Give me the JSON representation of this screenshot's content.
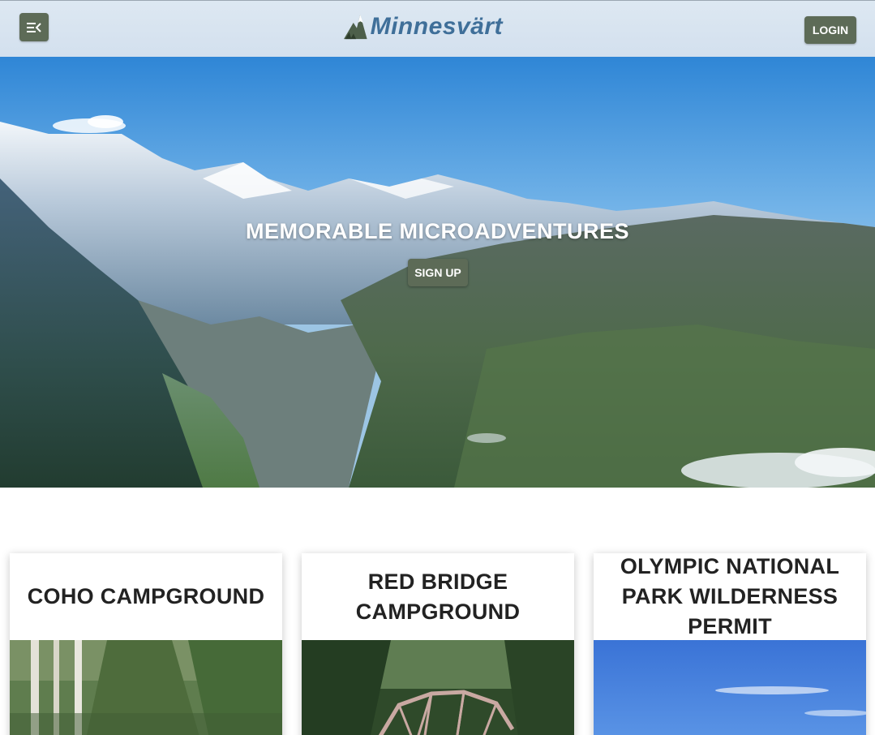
{
  "header": {
    "menu_icon": "menu-collapse-icon",
    "logo_text": "Minnesvärt",
    "login_label": "LOGIN"
  },
  "hero": {
    "title": "MEMORABLE MICROADVENTURES",
    "signup_label": "SIGN UP",
    "image": "mountain-valley-photo"
  },
  "cards": [
    {
      "title": "COHO CAMPGROUND",
      "image": "forest-photo"
    },
    {
      "title": "RED BRIDGE CAMPGROUND",
      "image": "red-bridge-photo"
    },
    {
      "title": "OLYMPIC NATIONAL PARK WILDERNESS PERMIT",
      "image": "blue-sky-photo"
    }
  ],
  "colors": {
    "accent_button": "#5d6b57",
    "header_bg": "#d3e0ee",
    "logo_blue": "#3f6f99"
  }
}
